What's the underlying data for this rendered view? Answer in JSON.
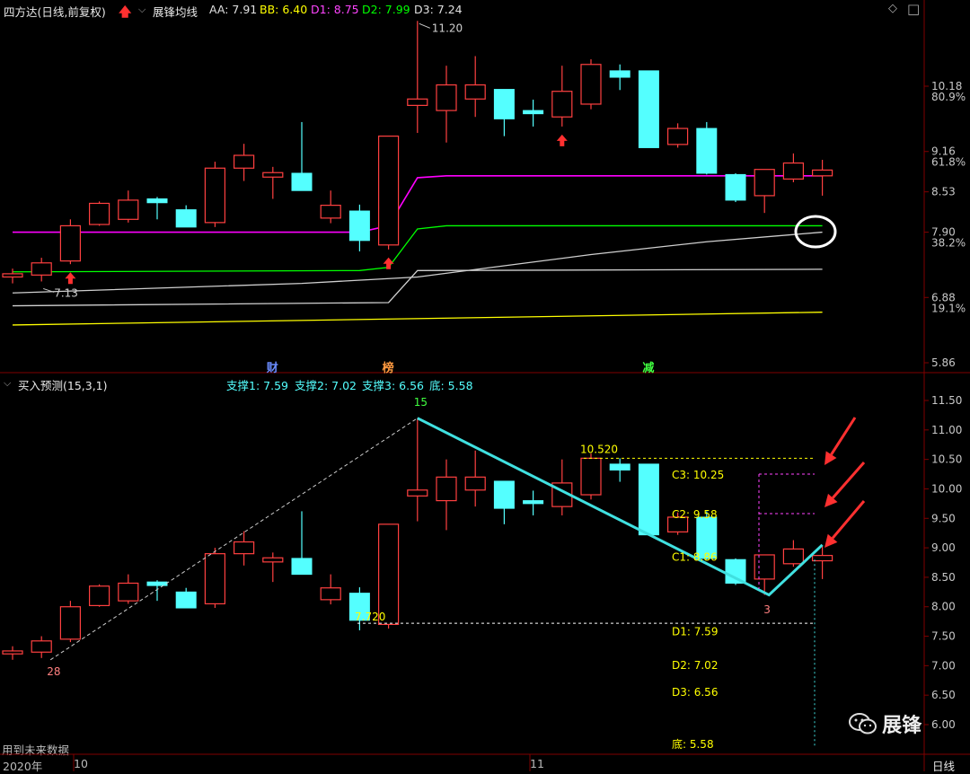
{
  "header": {
    "stock": "四方达(日线,前复权)",
    "indicator": "展锋均线",
    "aa": "AA: 7.91",
    "bb": "BB: 6.40",
    "d1": "D1: 8.75",
    "d2": "D2: 7.99",
    "d3": "D3: 7.24",
    "diamond_icon": "◇",
    "window_icon": "□"
  },
  "sub_header": {
    "title": "买入预测(15,3,1)",
    "support1": "支撑1: 7.59",
    "support2": "支撑2: 7.02",
    "support3": "支撑3: 6.56",
    "bottom": "底: 5.58"
  },
  "footer": {
    "future_note": "用到未来数据",
    "year_label": "2020年",
    "month_oct": "10",
    "month_nov": "11",
    "period": "日线"
  },
  "watermark": "展锋",
  "colors": {
    "up": "#ff4040",
    "down": "#54ffff",
    "aa_line": "#ff00ff",
    "bb_line": "#ffff00",
    "d1_line": "#ff44ff",
    "d2_line": "#00ff00",
    "d3_line": "#ffffff",
    "support_line": "#40e0e0",
    "arrow": "#ff3030"
  },
  "chart_data": [
    {
      "type": "candlestick",
      "name": "upper",
      "y_ticks": [
        {
          "value": 10.18,
          "label": "10.18",
          "pct": "80.9%"
        },
        {
          "value": 9.16,
          "label": "9.16",
          "pct": "61.8%"
        },
        {
          "value": 8.53,
          "label": "8.53"
        },
        {
          "value": 7.9,
          "label": "7.90",
          "pct": "38.2%"
        },
        {
          "value": 6.88,
          "label": "6.88",
          "pct": "19.1%"
        },
        {
          "value": 5.86,
          "label": "5.86"
        }
      ],
      "candles": [
        {
          "o": 7.2,
          "c": 7.25,
          "h": 7.33,
          "l": 7.1
        },
        {
          "o": 7.23,
          "c": 7.42,
          "h": 7.5,
          "l": 7.13
        },
        {
          "o": 7.45,
          "c": 8.0,
          "h": 8.1,
          "l": 7.4
        },
        {
          "o": 8.02,
          "c": 8.35,
          "h": 8.38,
          "l": 8.0
        },
        {
          "o": 8.1,
          "c": 8.4,
          "h": 8.55,
          "l": 8.05
        },
        {
          "o": 8.42,
          "c": 8.36,
          "h": 8.45,
          "l": 8.1
        },
        {
          "o": 8.25,
          "c": 7.98,
          "h": 8.32,
          "l": 7.98
        },
        {
          "o": 8.05,
          "c": 8.9,
          "h": 9.0,
          "l": 7.98
        },
        {
          "o": 8.9,
          "c": 9.1,
          "h": 9.28,
          "l": 8.7
        },
        {
          "o": 8.76,
          "c": 8.83,
          "h": 8.92,
          "l": 8.42
        },
        {
          "o": 8.82,
          "c": 8.55,
          "h": 9.62,
          "l": 8.55
        },
        {
          "o": 8.12,
          "c": 8.32,
          "h": 8.55,
          "l": 8.04
        },
        {
          "o": 8.23,
          "c": 7.77,
          "h": 8.33,
          "l": 7.6
        },
        {
          "o": 7.7,
          "c": 9.4,
          "h": 9.4,
          "l": 7.63
        },
        {
          "o": 9.88,
          "c": 9.98,
          "h": 11.2,
          "l": 9.45
        },
        {
          "o": 9.8,
          "c": 10.2,
          "h": 10.5,
          "l": 9.3
        },
        {
          "o": 9.98,
          "c": 10.2,
          "h": 10.65,
          "l": 9.7
        },
        {
          "o": 10.13,
          "c": 9.67,
          "h": 10.13,
          "l": 9.4
        },
        {
          "o": 9.8,
          "c": 9.75,
          "h": 9.97,
          "l": 9.55
        },
        {
          "o": 9.7,
          "c": 10.1,
          "h": 10.5,
          "l": 9.55
        },
        {
          "o": 9.9,
          "c": 10.52,
          "h": 10.6,
          "l": 9.82
        },
        {
          "o": 10.42,
          "c": 10.32,
          "h": 10.52,
          "l": 10.12
        },
        {
          "o": 10.42,
          "c": 9.22,
          "h": 10.42,
          "l": 9.22
        },
        {
          "o": 9.27,
          "c": 9.52,
          "h": 9.6,
          "l": 9.22
        },
        {
          "o": 9.52,
          "c": 8.82,
          "h": 9.62,
          "l": 8.8
        },
        {
          "o": 8.8,
          "c": 8.4,
          "h": 8.82,
          "l": 8.37
        },
        {
          "o": 8.47,
          "c": 8.88,
          "h": 8.88,
          "l": 8.2
        },
        {
          "o": 8.73,
          "c": 8.98,
          "h": 9.13,
          "l": 8.68
        },
        {
          "o": 8.78,
          "c": 8.87,
          "h": 9.03,
          "l": 8.47
        }
      ],
      "aa_line": [
        {
          "x": 0,
          "y": 7.9
        },
        {
          "x": 12,
          "y": 7.9
        },
        {
          "x": 13,
          "y": 8.0
        },
        {
          "x": 14,
          "y": 8.75
        },
        {
          "x": 15,
          "y": 8.78
        },
        {
          "x": 28,
          "y": 8.78
        }
      ],
      "d2_line": [
        {
          "x": 0,
          "y": 7.28
        },
        {
          "x": 12,
          "y": 7.3
        },
        {
          "x": 13,
          "y": 7.35
        },
        {
          "x": 14,
          "y": 7.95
        },
        {
          "x": 15,
          "y": 8.0
        },
        {
          "x": 28,
          "y": 8.0
        }
      ],
      "bb_line": [
        {
          "x": 0,
          "y": 6.45
        },
        {
          "x": 28,
          "y": 6.65
        }
      ],
      "d3_line": [
        {
          "x": 0,
          "y": 6.75
        },
        {
          "x": 13,
          "y": 6.8
        },
        {
          "x": 14,
          "y": 7.3
        },
        {
          "x": 28,
          "y": 7.32
        }
      ],
      "ma_line": [
        {
          "x": 0,
          "y": 6.95
        },
        {
          "x": 10,
          "y": 7.1
        },
        {
          "x": 14,
          "y": 7.2
        },
        {
          "x": 20,
          "y": 7.55
        },
        {
          "x": 24,
          "y": 7.75
        },
        {
          "x": 28,
          "y": 7.9
        }
      ],
      "annotations": {
        "high_label": "11.20",
        "low_label": "7.13",
        "buy_arrow_indices": [
          2,
          13,
          19
        ],
        "markers": [
          {
            "index": 9,
            "text": "财"
          },
          {
            "index": 13,
            "text": "榜"
          },
          {
            "index": 22,
            "text": "减"
          }
        ]
      }
    },
    {
      "type": "candlestick",
      "name": "lower",
      "y_ticks": [
        {
          "value": 11.5,
          "label": "11.50"
        },
        {
          "value": 11.0,
          "label": "11.00"
        },
        {
          "value": 10.5,
          "label": "10.50"
        },
        {
          "value": 10.0,
          "label": "10.00"
        },
        {
          "value": 9.5,
          "label": "9.50"
        },
        {
          "value": 9.0,
          "label": "9.00"
        },
        {
          "value": 8.5,
          "label": "8.50"
        },
        {
          "value": 8.0,
          "label": "8.00"
        },
        {
          "value": 7.5,
          "label": "7.50"
        },
        {
          "value": 7.0,
          "label": "7.00"
        },
        {
          "value": 6.5,
          "label": "6.50"
        },
        {
          "value": 6.0,
          "label": "6.00"
        }
      ],
      "zigzag_labels": {
        "low_left": "28",
        "peak": "15",
        "low_right": "3"
      },
      "resistance": [
        {
          "label": "10.520",
          "value": 10.52
        },
        {
          "label": "C3: 10.25",
          "value": 10.25
        },
        {
          "label": "C2: 9.58",
          "value": 9.58
        },
        {
          "label": "C1: 8.86",
          "value": 8.86
        }
      ],
      "support": [
        {
          "label": "7.720",
          "value": 7.72
        },
        {
          "label": "D1: 7.59",
          "value": 7.59
        },
        {
          "label": "D2: 7.02",
          "value": 7.02
        },
        {
          "label": "D3: 6.56",
          "value": 6.56
        },
        {
          "label": "底: 5.58",
          "value": 5.58
        }
      ]
    }
  ]
}
